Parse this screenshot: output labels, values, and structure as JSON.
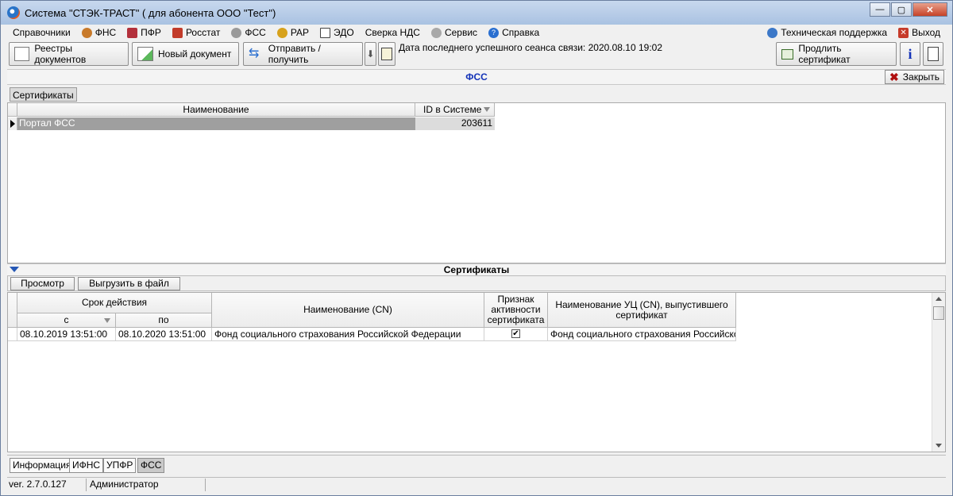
{
  "window": {
    "title": "Система \"СТЭК-ТРАСТ\" ( для абонента ООО \"Тест\")"
  },
  "menu": {
    "items": [
      "Справочники",
      "ФНС",
      "ПФР",
      "Росстат",
      "ФСС",
      "РАР",
      "ЭДО",
      "Сверка НДС",
      "Сервис",
      "Справка"
    ],
    "support": "Техническая поддержка",
    "exit": "Выход"
  },
  "toolbar": {
    "registries": "Реестры документов",
    "new_doc": "Новый документ",
    "send_receive": "Отправить / получить",
    "last_session": "Дата последнего успешного сеанса связи: 2020.08.10 19:02",
    "renew_cert": "Продлить сертификат"
  },
  "panel": {
    "title": "ФСС",
    "close": "Закрыть",
    "subtab": "Сертификаты"
  },
  "grid1": {
    "columns": [
      "Наименование",
      "ID в Системе"
    ],
    "rows": [
      {
        "name": "Портал ФСС",
        "id": "203611"
      }
    ]
  },
  "certs": {
    "title": "Сертификаты",
    "view": "Просмотр",
    "export": "Выгрузить в файл",
    "headers": {
      "validity": "Срок действия",
      "from": "с",
      "to": "по",
      "cn": "Наименование (CN)",
      "active": "Признак активности сертификата",
      "issuer": "Наименование УЦ (CN), выпустившего сертификат"
    },
    "rows": [
      {
        "from": "08.10.2019 13:51:00",
        "to": "08.10.2020 13:51:00",
        "cn": "Фонд социального страхования Российской Федерации",
        "active": "✔",
        "issuer": "Фонд социального страхования Российско..."
      }
    ]
  },
  "tabs": [
    "Информация",
    "ИФНС",
    "УПФР",
    "ФСС"
  ],
  "status": {
    "version": "ver. 2.7.0.127",
    "user": "Администратор"
  },
  "colors": {
    "panel_title": "#1433b8",
    "accent": "#2658b5",
    "close_red": "#c64227"
  }
}
